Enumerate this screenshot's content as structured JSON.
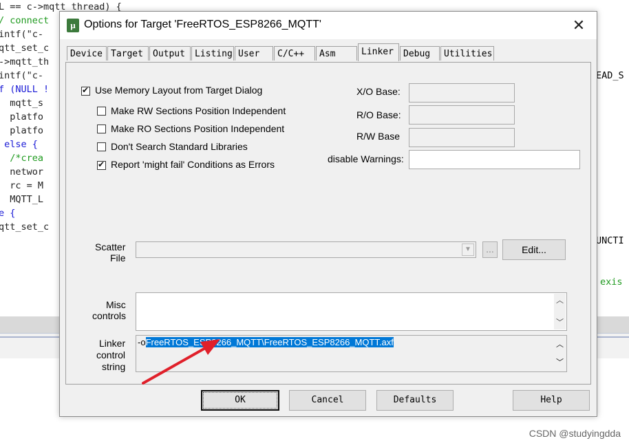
{
  "background_code": [
    {
      "text": "L == c->mqtt_thread) {",
      "cls": ""
    },
    {
      "text": "/ connect",
      "cls": "cm"
    },
    {
      "text": "intf(\"c-",
      "cls": ""
    },
    {
      "text": "qtt_set_c",
      "cls": ""
    },
    {
      "text": "->mqtt_th",
      "cls": ""
    },
    {
      "text": "intf(\"c-",
      "cls": ""
    },
    {
      "text": "f (NULL !",
      "cls": "kw"
    },
    {
      "text": "  mqtt_s",
      "cls": ""
    },
    {
      "text": "  platfo",
      "cls": ""
    },
    {
      "text": "  platfo",
      "cls": ""
    },
    {
      "text": " else {",
      "cls": "kw"
    },
    {
      "text": "  /*crea",
      "cls": "cm"
    },
    {
      "text": "  networ",
      "cls": ""
    },
    {
      "text": "  rc = M",
      "cls": ""
    },
    {
      "text": "  MQTT_L",
      "cls": ""
    },
    {
      "text": "e {",
      "cls": "kw"
    },
    {
      "text": "qtt_set_c",
      "cls": ""
    }
  ],
  "background_right": [
    "EAD_S",
    "UNCTI",
    "exis"
  ],
  "dialog": {
    "title": "Options for Target 'FreeRTOS_ESP8266_MQTT'",
    "close": "✕",
    "app_icon": "µ"
  },
  "tabs": [
    "Device",
    "Target",
    "Output",
    "Listing",
    "User",
    "C/C++",
    "Asm",
    "Linker",
    "Debug",
    "Utilities"
  ],
  "active_tab": "Linker",
  "options": {
    "use_memory_layout": {
      "label": "Use Memory Layout from Target Dialog",
      "checked": true
    },
    "make_rw": {
      "label": "Make RW Sections Position Independent",
      "checked": false
    },
    "make_ro": {
      "label": "Make RO Sections Position Independent",
      "checked": false
    },
    "dont_search": {
      "label": "Don't Search Standard Libraries",
      "checked": false
    },
    "report_might_fail": {
      "label": "Report 'might fail' Conditions as Errors",
      "checked": true
    }
  },
  "right_fields": {
    "xo_base": "X/O Base:",
    "ro_base": "R/O Base:",
    "rw_base": "R/W Base",
    "disable_warnings": "disable Warnings:"
  },
  "scatter": {
    "label_line1": "Scatter",
    "label_line2": "File",
    "browse": "...",
    "edit": "Edit..."
  },
  "misc": {
    "label_line1": "Misc",
    "label_line2": "controls"
  },
  "linker": {
    "label_line1": "Linker",
    "label_line2": "control",
    "label_line3": "string",
    "prefix": "-o",
    "selected": "FreeRTOS_ESP8266_MQTT\\FreeRTOS_ESP8266_MQTT.axf"
  },
  "buttons": {
    "ok": "OK",
    "cancel": "Cancel",
    "defaults": "Defaults",
    "help": "Help"
  },
  "watermark": "CSDN @studyingdda",
  "colors": {
    "selection": "#0078d7",
    "arrow": "#e0202a"
  }
}
